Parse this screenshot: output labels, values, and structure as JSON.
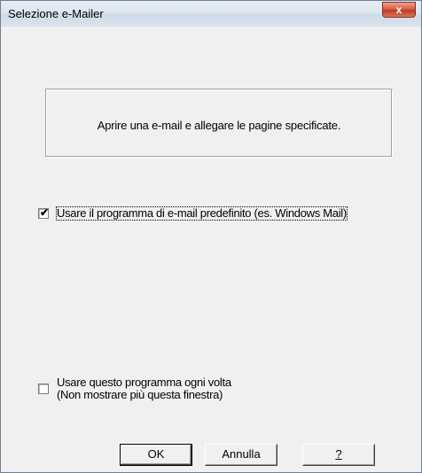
{
  "window": {
    "title": "Selezione e-Mailer",
    "close_glyph": "x"
  },
  "info": {
    "text": "Aprire una e-mail e allegare le pagine specificate."
  },
  "options": {
    "use_default": {
      "label": "Usare il programma di e-mail predefinito (es. Windows Mail)",
      "checked": true,
      "check_glyph": "✔"
    },
    "always_use": {
      "line1": "Usare questo programma ogni volta",
      "line2": "(Non mostrare più questa finestra)",
      "checked": false
    }
  },
  "buttons": {
    "ok": "OK",
    "cancel": "Annulla",
    "help": "?"
  }
}
